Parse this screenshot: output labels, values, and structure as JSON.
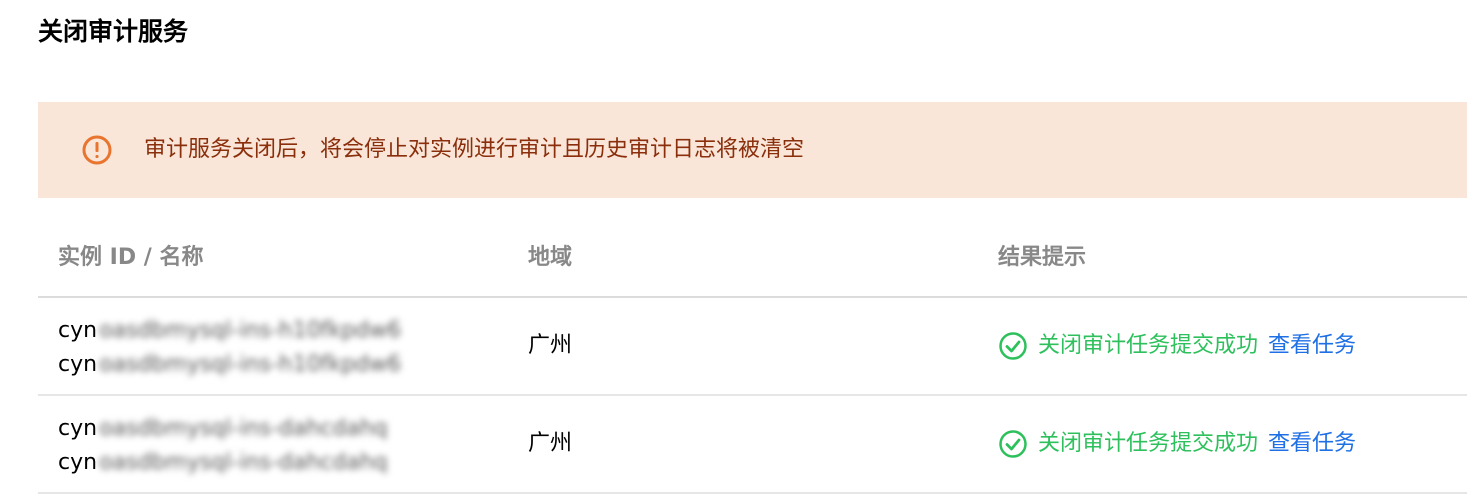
{
  "dialog": {
    "title": "关闭审计服务"
  },
  "alert": {
    "icon": "warning-circle-icon",
    "color": "#8a2e0b",
    "background": "#f9e6d8",
    "text": "审计服务关闭后，将会停止对实例进行审计且历史审计日志将被清空"
  },
  "table": {
    "headers": {
      "instance": "实例 ID / 名称",
      "region": "地域",
      "result": "结果提示"
    },
    "rows": [
      {
        "id_prefix": "cyn",
        "id_blurred": "oasdbmysql-ins-h10fkpdw6",
        "name_prefix": "cyn",
        "name_blurred": "oasdbmysql-ins-h10fkpdw6",
        "region": "广州",
        "status_icon": "check-circle-icon",
        "status": "关闭审计任务提交成功",
        "action": "查看任务"
      },
      {
        "id_prefix": "cyn",
        "id_blurred": "oasdbmysql-ins-dahcdahq",
        "name_prefix": "cyn",
        "name_blurred": "oasdbmysql-ins-dahcdahq",
        "region": "广州",
        "status_icon": "check-circle-icon",
        "status": "关闭审计任务提交成功",
        "action": "查看任务"
      }
    ]
  },
  "colors": {
    "success": "#2ec05c",
    "link": "#1f6fe5",
    "header_text": "#888888"
  }
}
